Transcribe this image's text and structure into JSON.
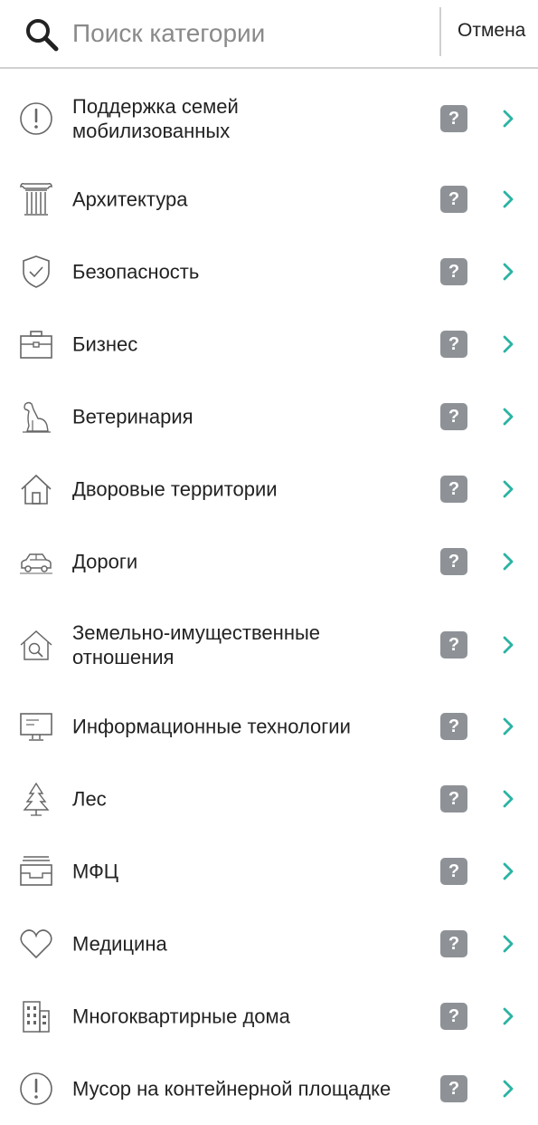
{
  "search": {
    "placeholder": "Поиск категории"
  },
  "header": {
    "cancel_label": "Отмена"
  },
  "colors": {
    "accent": "#2ab3a2",
    "help_badge": "#8e9297",
    "icon_stroke": "#666666"
  },
  "categories": [
    {
      "label": " Поддержка семей\nмобилизованных",
      "icon": "exclamation-circle-icon",
      "help": "?"
    },
    {
      "label": "Архитектура",
      "icon": "column-icon",
      "help": "?"
    },
    {
      "label": "Безопасность",
      "icon": "shield-check-icon",
      "help": "?"
    },
    {
      "label": "Бизнес",
      "icon": "briefcase-icon",
      "help": "?"
    },
    {
      "label": "Ветеринария",
      "icon": "dog-icon",
      "help": "?"
    },
    {
      "label": "Дворовые территории",
      "icon": "house-icon",
      "help": "?"
    },
    {
      "label": "Дороги",
      "icon": "car-icon",
      "help": "?"
    },
    {
      "label": "Земельно-имущественные\nотношения",
      "icon": "house-search-icon",
      "help": "?"
    },
    {
      "label": "Информационные технологии",
      "icon": "monitor-icon",
      "help": "?"
    },
    {
      "label": "Лес",
      "icon": "tree-icon",
      "help": "?"
    },
    {
      "label": "МФЦ",
      "icon": "inbox-tray-icon",
      "help": "?"
    },
    {
      "label": "Медицина",
      "icon": "heart-icon",
      "help": "?"
    },
    {
      "label": "Многоквартирные дома",
      "icon": "building-icon",
      "help": "?"
    },
    {
      "label": "Мусор на контейнерной площадке",
      "icon": "exclamation-circle-icon",
      "help": "?"
    }
  ]
}
